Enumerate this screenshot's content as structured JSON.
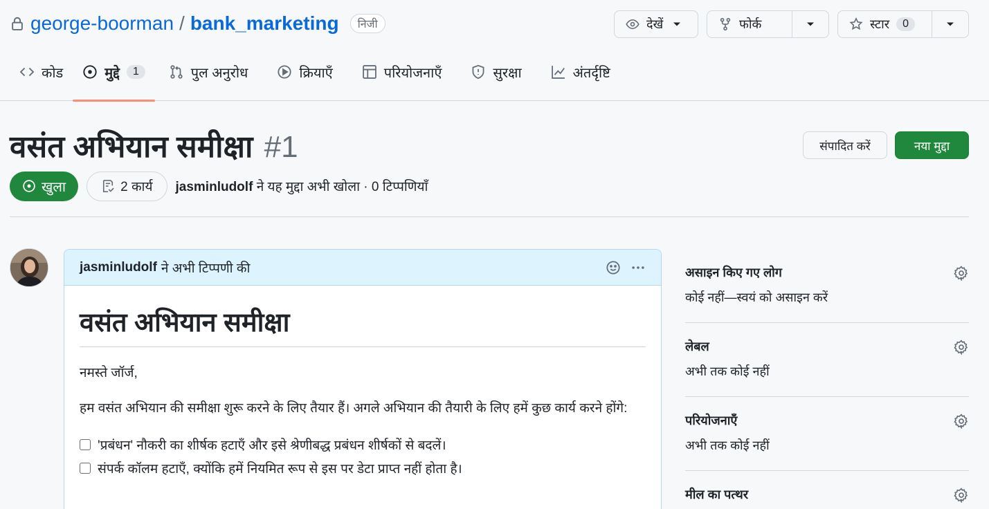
{
  "repo": {
    "owner": "george-boorman",
    "separator": "/",
    "name": "bank_marketing",
    "visibility": "निजी"
  },
  "header_buttons": {
    "watch_label": "देखें",
    "fork_label": "फोर्क",
    "star_label": "स्टार",
    "star_count": "0"
  },
  "tabs": [
    {
      "label": "कोड"
    },
    {
      "label": "मुद्दे",
      "count": "1"
    },
    {
      "label": "पुल अनुरोध"
    },
    {
      "label": "क्रियाएँ"
    },
    {
      "label": "परियोजनाएँ"
    },
    {
      "label": "सुरक्षा"
    },
    {
      "label": "अंतर्दृष्टि"
    }
  ],
  "issue": {
    "title": "वसंत अभियान समीक्षा",
    "number": "#1",
    "edit_label": "संपादित करें",
    "new_label": "नया मुद्दा",
    "state": "खुला",
    "tasks": "2 कार्य",
    "author": "jasminludolf",
    "meta_rest": "ने यह मुद्दा अभी खोला · 0 टिप्पणियाँ"
  },
  "comment": {
    "author": "jasminludolf",
    "action_text": "ने अभी टिप्पणी की",
    "heading": "वसंत अभियान समीक्षा",
    "greeting": "नमस्ते जॉर्ज,",
    "paragraph": "हम वसंत अभियान की समीक्षा शुरू करने के लिए तैयार हैं। अगले अभियान की तैयारी के लिए हमें कुछ कार्य करने होंगे:",
    "tasks": [
      "'प्रबंधन' नौकरी का शीर्षक हटाएँ और इसे श्रेणीबद्ध प्रबंधन शीर्षकों से बदलें।",
      "संपर्क कॉलम हटाएँ, क्योंकि हमें नियमित रूप से इस पर डेटा प्राप्त नहीं होता है।"
    ]
  },
  "sidebar": {
    "assignees": {
      "title": "असाइन किए गए लोग",
      "value": "कोई नहीं—स्वयं को असाइन करें"
    },
    "labels": {
      "title": "लेबल",
      "value": "अभी तक कोई नहीं"
    },
    "projects": {
      "title": "परियोजनाएँ",
      "value": "अभी तक कोई नहीं"
    },
    "milestone": {
      "title": "मील का पत्थर"
    }
  }
}
